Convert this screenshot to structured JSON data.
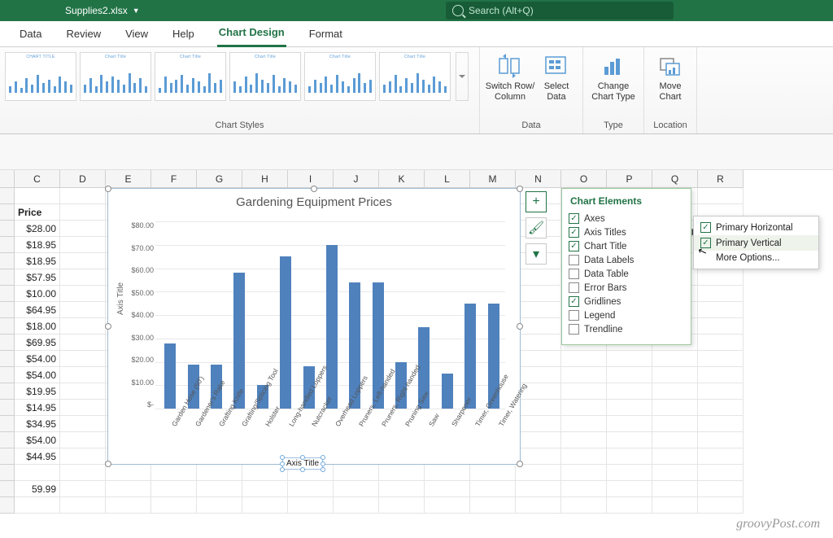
{
  "titlebar": {
    "filename": "Supplies2.xlsx"
  },
  "search": {
    "placeholder": "Search (Alt+Q)"
  },
  "tabs": [
    "Data",
    "Review",
    "View",
    "Help",
    "Chart Design",
    "Format"
  ],
  "active_tab": "Chart Design",
  "ribbon": {
    "groups": {
      "styles": "Chart Styles",
      "data": "Data",
      "type": "Type",
      "location": "Location"
    },
    "thumb_title": "Chart Title",
    "buttons": {
      "switch": "Switch Row/\nColumn",
      "select_data": "Select\nData",
      "change_type": "Change\nChart Type",
      "move_chart": "Move\nChart"
    }
  },
  "columns": [
    "C",
    "D",
    "E",
    "F",
    "G",
    "H",
    "I",
    "J",
    "K",
    "L",
    "M",
    "N",
    "O",
    "P",
    "Q",
    "R"
  ],
  "price_header": "Price",
  "prices": [
    "$28.00",
    "$18.95",
    "$18.95",
    "$57.95",
    "$10.00",
    "$64.95",
    "$18.00",
    "$69.95",
    "$54.00",
    "$54.00",
    "$19.95",
    "$14.95",
    "$34.95",
    "$54.00",
    "$44.95",
    "",
    "59.99"
  ],
  "chart_data": {
    "type": "bar",
    "title": "Gardening Equipment Prices",
    "ylabel": "Axis Title",
    "xlabel": "Axis Title",
    "ylim": [
      0,
      80
    ],
    "yticks": [
      "$80.00",
      "$70.00",
      "$60.00",
      "$50.00",
      "$40.00",
      "$30.00",
      "$20.00",
      "$10.00",
      "$-"
    ],
    "categories": [
      "Garden Hose (50')",
      "Gardener's Rake",
      "Grafting Knife",
      "Grafting/Splicing Tool",
      "Holster",
      "Long-handled Loppers",
      "Nutcracker",
      "Overhead Loppers",
      "Pruners, Left-handed",
      "Pruners, Right-handed",
      "Pruning Saw",
      "Saw",
      "Sharpener",
      "Timer, Greenhouse",
      "Timer, Watering"
    ],
    "values": [
      28,
      18.95,
      18.95,
      57.95,
      10,
      64.95,
      18,
      69.95,
      54,
      54,
      19.95,
      34.95,
      14.95,
      44.95,
      44.95
    ]
  },
  "chart_elements": {
    "title": "Chart Elements",
    "items": [
      {
        "label": "Axes",
        "checked": true
      },
      {
        "label": "Axis Titles",
        "checked": true
      },
      {
        "label": "Chart Title",
        "checked": true
      },
      {
        "label": "Data Labels",
        "checked": false
      },
      {
        "label": "Data Table",
        "checked": false
      },
      {
        "label": "Error Bars",
        "checked": false
      },
      {
        "label": "Gridlines",
        "checked": true
      },
      {
        "label": "Legend",
        "checked": false
      },
      {
        "label": "Trendline",
        "checked": false
      }
    ],
    "submenu": [
      {
        "label": "Primary Horizontal",
        "checked": true
      },
      {
        "label": "Primary Vertical",
        "checked": true
      },
      {
        "label": "More Options...",
        "checked": null
      }
    ]
  },
  "watermark": "groovyPost.com"
}
